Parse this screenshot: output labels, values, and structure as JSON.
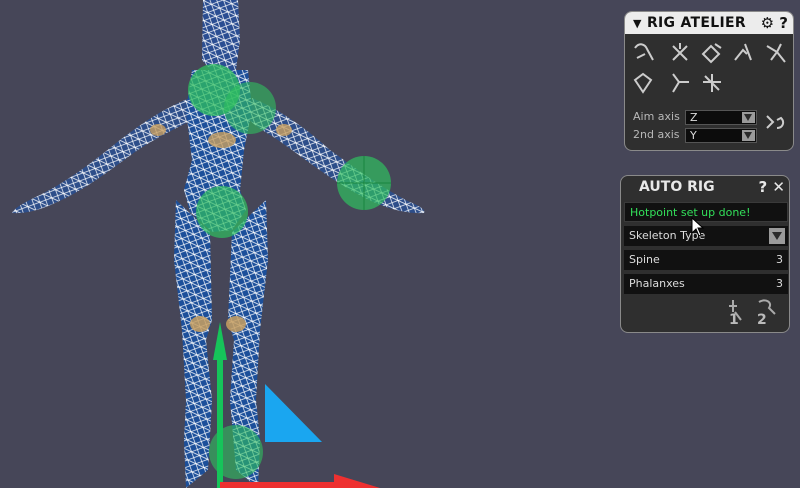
{
  "rig_atelier": {
    "title": "RIG ATELIER",
    "collapse_icon": "triangle-down-icon",
    "settings_icon": "gear-icon",
    "help_icon": "question-icon",
    "tools": [
      "tool-1",
      "tool-2",
      "tool-3",
      "tool-4",
      "tool-5",
      "tool-6",
      "tool-7",
      "tool-8"
    ],
    "aim_axis_label": "Aim axis",
    "aim_axis_value": "Z",
    "second_axis_label": "2nd axis",
    "second_axis_value": "Y",
    "orient_icon": "orient-icon"
  },
  "auto_rig": {
    "title": "AUTO RIG",
    "help_icon": "question-icon",
    "close_icon": "close-icon",
    "status": "Hotpoint set up done!",
    "skeleton_type_label": "Skeleton Type",
    "spine_label": "Spine",
    "spine_value": "3",
    "phalanxes_label": "Phalanxes",
    "phalanxes_value": "3",
    "step1_icon": "step-1-icon",
    "step2_icon": "step-2-icon",
    "step1_label": "1",
    "step2_label": "2"
  },
  "colors": {
    "viewport_bg": "#464658",
    "hotpoint": "#2fbf5f",
    "mesh": "#ffffff",
    "mesh_fill": "#1c4f9a",
    "axis_y": "#16c45a",
    "axis_x": "#ee3030",
    "axis_z": "#1aa6f0",
    "status_text": "#33e05a"
  }
}
